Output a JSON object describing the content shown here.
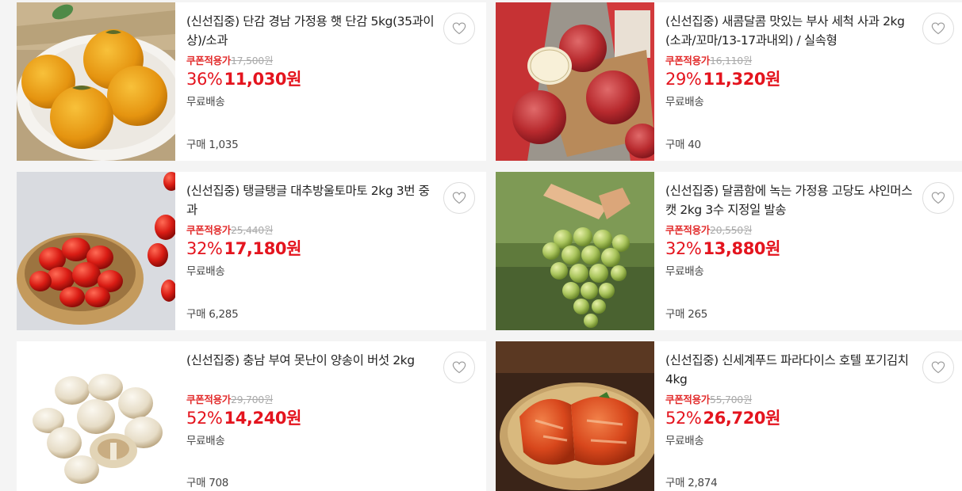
{
  "products": [
    {
      "title": "(신선집중) 단감 경남 가정용 햇 단감 5kg(35과이상)/소과",
      "coupon_label": "쿠폰적용가",
      "original_price": "17,500원",
      "discount_rate": "36%",
      "price": "11,030원",
      "shipping": "무료배송",
      "purchases": "구매 1,035",
      "image_icon": "persimmon-image"
    },
    {
      "title": "(신선집중) 새콤달콤 맛있는 부사 세척 사과 2kg (소과/꼬마/13-17과내외) / 실속형",
      "coupon_label": "쿠폰적용가",
      "original_price": "16,110원",
      "discount_rate": "29%",
      "price": "11,320원",
      "shipping": "무료배송",
      "purchases": "구매 40",
      "image_icon": "apple-image"
    },
    {
      "title": "(신선집중) 탱글탱글 대추방울토마토 2kg 3번 중과",
      "coupon_label": "쿠폰적용가",
      "original_price": "25,440원",
      "discount_rate": "32%",
      "price": "17,180원",
      "shipping": "무료배송",
      "purchases": "구매 6,285",
      "image_icon": "cherry-tomato-image"
    },
    {
      "title": "(신선집중) 달콤함에 녹는 가정용 고당도 샤인머스캣 2kg 3수 지정일 발송",
      "coupon_label": "쿠폰적용가",
      "original_price": "20,550원",
      "discount_rate": "32%",
      "price": "13,880원",
      "shipping": "무료배송",
      "purchases": "구매 265",
      "image_icon": "shine-muscat-image"
    },
    {
      "title": "(신선집중) 충남 부여 못난이 양송이 버섯 2kg",
      "coupon_label": "쿠폰적용가",
      "original_price": "29,700원",
      "discount_rate": "52%",
      "price": "14,240원",
      "shipping": "무료배송",
      "purchases": "구매 708",
      "image_icon": "mushroom-image"
    },
    {
      "title": "(신선집중) 신세계푸드 파라다이스 호텔 포기김치 4kg",
      "coupon_label": "쿠폰적용가",
      "original_price": "55,700원",
      "discount_rate": "52%",
      "price": "26,720원",
      "shipping": "무료배송",
      "purchases": "구매 2,874",
      "image_icon": "kimchi-image"
    }
  ],
  "colors": {
    "sale": "#e4141e",
    "coupon": "#e22b2b",
    "strike": "#aaaaaa"
  },
  "wishlist_icon": "heart-icon"
}
